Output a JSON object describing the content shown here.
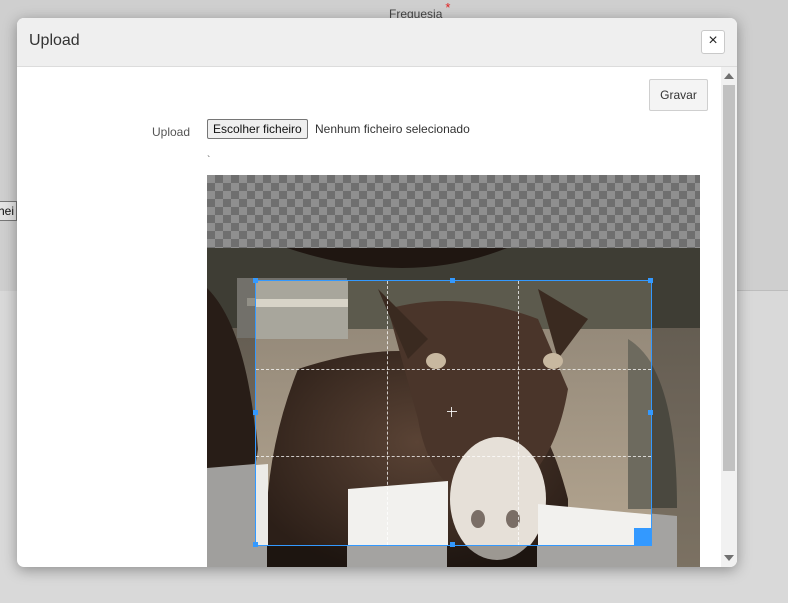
{
  "background": {
    "field_label": "Freguesia",
    "required_mark": "*",
    "fragment_text": "hei"
  },
  "modal": {
    "title": "Upload",
    "close_symbol": "×",
    "save_label": "Gravar",
    "upload_label": "Upload",
    "file_button_label": "Escolher ficheiro",
    "file_status": "Nenhum ficheiro selecionado",
    "tick_mark": "`"
  },
  "cropper": {
    "image_subject": "donkey behind white fence",
    "accent": "#3399ff"
  },
  "icons": {
    "close": "close-icon",
    "scroll_up": "arrow-up-icon",
    "scroll_down": "arrow-down-icon"
  }
}
